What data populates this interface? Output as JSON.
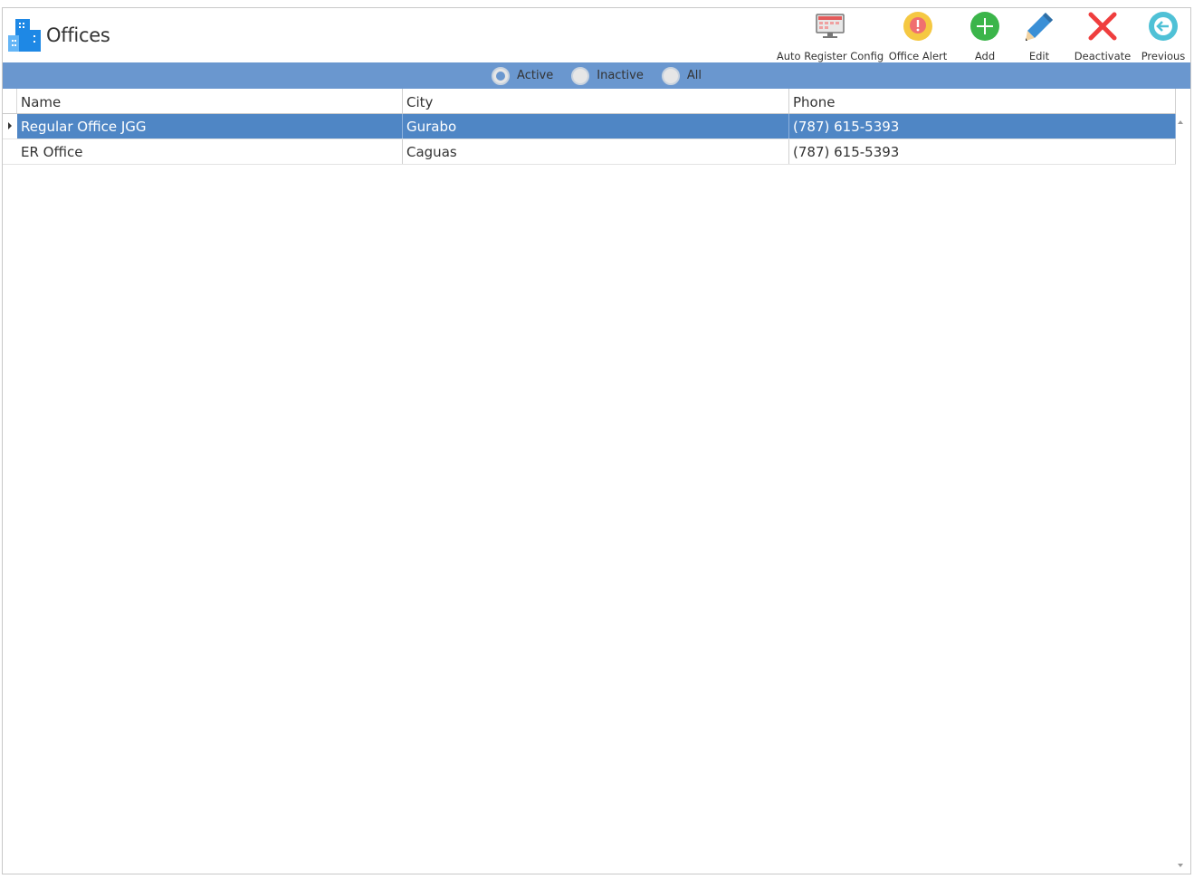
{
  "page": {
    "title": "Offices"
  },
  "toolbar": {
    "auto_register_label": "Auto Register Config",
    "office_alert_label": "Office Alert",
    "add_label": "Add",
    "edit_label": "Edit",
    "deactivate_label": "Deactivate",
    "previous_label": "Previous"
  },
  "filter": {
    "options": [
      {
        "label": "Active",
        "selected": true
      },
      {
        "label": "Inactive",
        "selected": false
      },
      {
        "label": "All",
        "selected": false
      }
    ]
  },
  "table": {
    "columns": [
      "Name",
      "City",
      "Phone"
    ],
    "rows": [
      {
        "name": "Regular Office JGG",
        "city": "Gurabo",
        "phone": "(787) 615-5393",
        "selected": true
      },
      {
        "name": "ER Office",
        "city": "Caguas",
        "phone": "(787) 615-5393",
        "selected": false
      }
    ]
  },
  "colors": {
    "filter_bar": "#6a97cf",
    "selected_row": "#4f86c5",
    "add_green": "#3bb54a",
    "deactivate_red": "#ef3e3e",
    "previous_teal": "#4fc1d6",
    "alert_yellow": "#f5c842",
    "title_icon_blue": "#1e88e5"
  },
  "icons": {
    "title": "building-icon",
    "auto_register": "monitor-calendar-icon",
    "office_alert": "alert-icon",
    "add": "plus-circle-icon",
    "edit": "pencil-icon",
    "deactivate": "x-icon",
    "previous": "arrow-left-circle-icon"
  }
}
